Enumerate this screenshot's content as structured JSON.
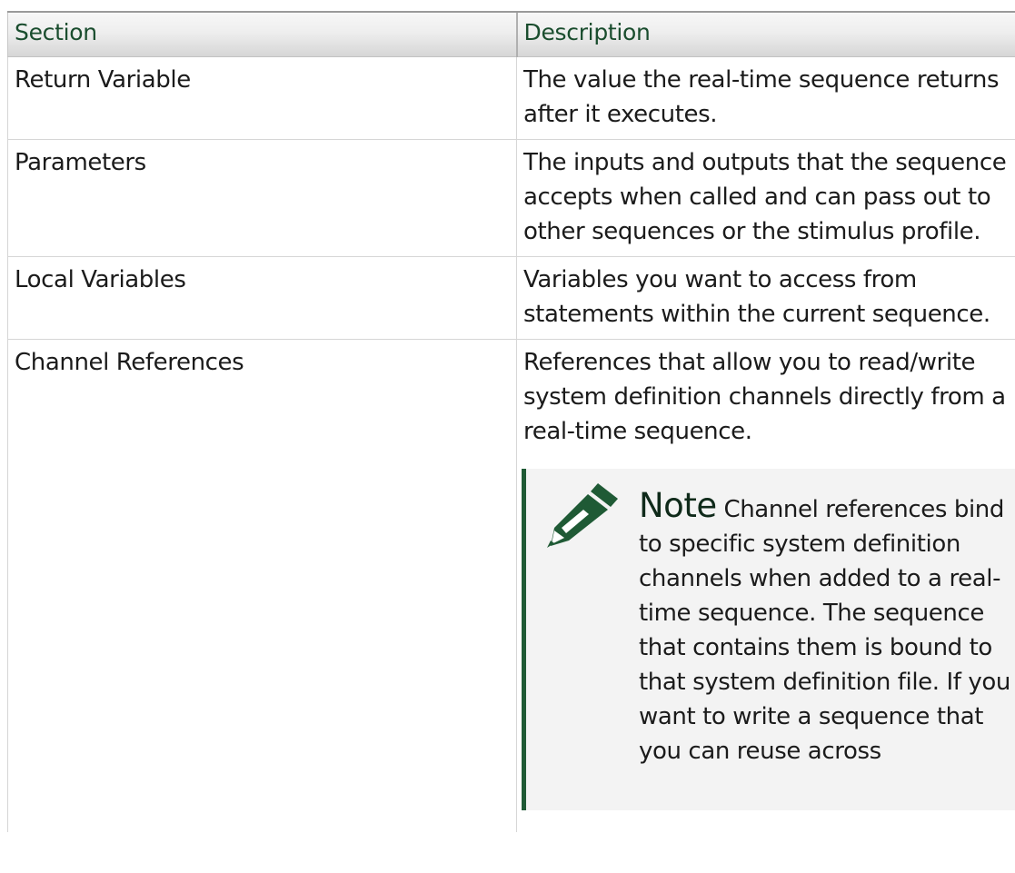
{
  "table": {
    "headers": {
      "section": "Section",
      "description": "Description"
    },
    "rows": [
      {
        "section": "Return Variable",
        "description": "The value the real-time sequence returns after it executes."
      },
      {
        "section": "Parameters",
        "description": "The inputs and outputs that the sequence accepts when called and can pass out to other sequences or the stimulus profile."
      },
      {
        "section": "Local Variables",
        "description": "Variables you want to access from statements within the current sequence."
      },
      {
        "section": "Channel References",
        "description": "References that allow you to read/write system definition channels directly from a real-time sequence.",
        "note": {
          "icon": "pencil-icon",
          "title": "Note",
          "text": "Channel references bind to specific system definition channels when added to a real-time sequence. The sequence that contains them is bound to that system definition file. If you want to write a sequence that you can reuse across"
        }
      }
    ]
  },
  "colors": {
    "header_text": "#1a4d2e",
    "note_bar": "#1f5a35",
    "note_bg": "#f3f3f3",
    "icon": "#1f5a35"
  }
}
